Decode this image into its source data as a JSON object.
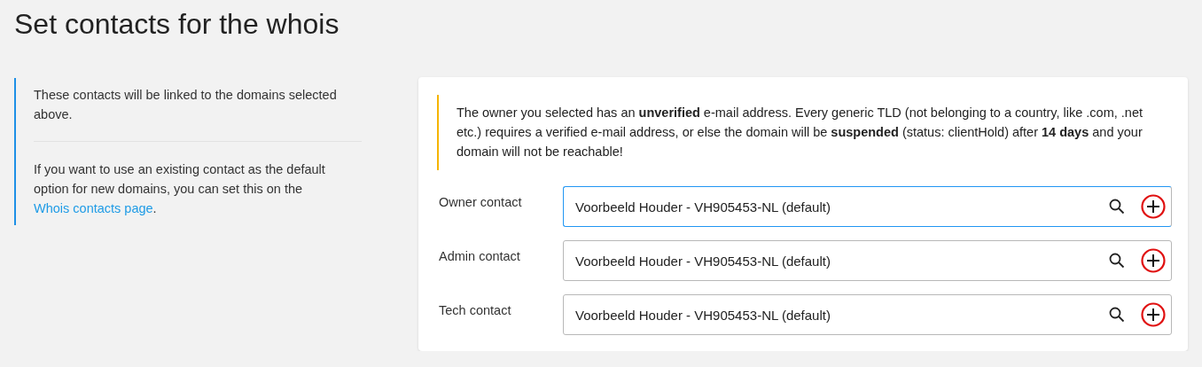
{
  "page": {
    "title": "Set contacts for the whois"
  },
  "info": {
    "paragraphs": [
      "These contacts will be linked to the domains selected above.",
      "If you want to use an existing contact as the default option for new domains, you can set this on the"
    ],
    "link": "Whois contacts page",
    "link_suffix": "."
  },
  "warning": {
    "text": "The owner you selected has an **unverified** e-mail address. Every generic TLD (not belonging to a country, like .com, .net etc.) requires a verified e-mail address, or else the domain will be **suspended** (status: clientHold) after **14 days** and your domain will not be reachable!"
  },
  "contacts": [
    {
      "label": "Owner contact",
      "value": "Voorbeeld Houder - VH905453-NL (default)",
      "focused": true
    },
    {
      "label": "Admin contact",
      "value": "Voorbeeld Houder - VH905453-NL (default)",
      "focused": false
    },
    {
      "label": "Tech contact",
      "value": "Voorbeeld Houder - VH905453-NL (default)",
      "focused": false
    }
  ]
}
